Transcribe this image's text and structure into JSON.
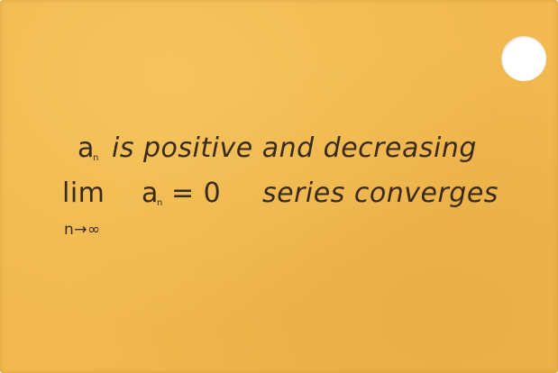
{
  "card": {
    "line1": {
      "term": "a",
      "subscript": "n",
      "text": "is positive and decreasing"
    },
    "line2": {
      "lim": "lim",
      "limit_subscript": "n→∞",
      "term": "a",
      "subscript": "n",
      "equals": "= 0",
      "conclusion": "series converges"
    }
  },
  "colors": {
    "card": "#f1b94f",
    "ink": "#3a2a1c",
    "hole": "#ffffff"
  }
}
